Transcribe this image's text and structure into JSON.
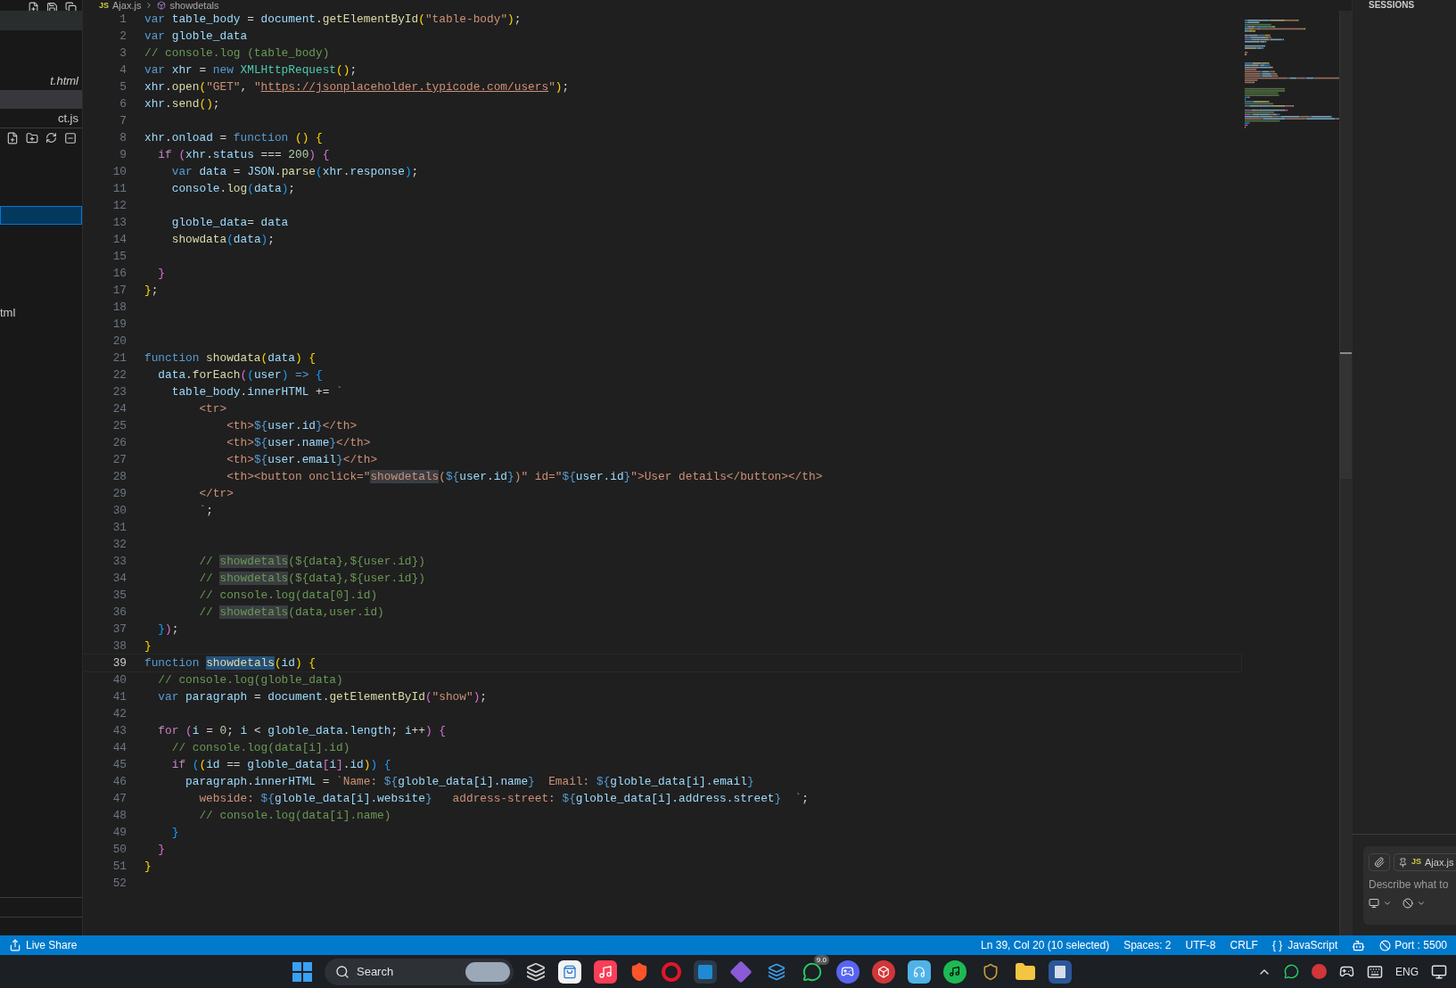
{
  "sidebar": {
    "files": [
      {
        "label": "t.html",
        "italic": true,
        "selected": false
      },
      {
        "selected": true
      },
      {
        "label": "ct.js",
        "italic": false,
        "selected": false
      }
    ],
    "tree": [
      {
        "focused": true
      },
      {
        "label": "tml",
        "focused": false
      }
    ]
  },
  "breadcrumb": {
    "file_badge": "JS",
    "file": "Ajax.js",
    "symbol": "showdetals"
  },
  "editor": {
    "lines": [
      {
        "number": "1",
        "current": false,
        "tokens": [
          {
            "text": "var",
            "kind": "kw"
          },
          {
            "text": " table_body",
            "kind": "v"
          },
          {
            "text": " = ",
            "kind": "p"
          },
          {
            "text": "document",
            "kind": "v"
          },
          {
            "text": ".",
            "kind": "p"
          },
          {
            "text": "getElementById",
            "kind": "fn"
          },
          {
            "text": "(",
            "kind": "b1"
          },
          {
            "text": "\"table-body\"",
            "kind": "str"
          },
          {
            "text": ")",
            "kind": "b1"
          },
          {
            "text": ";",
            "kind": "p"
          }
        ]
      },
      {
        "number": "2",
        "current": false,
        "tokens": [
          {
            "text": "var",
            "kind": "kw"
          },
          {
            "text": " globle_data",
            "kind": "v"
          }
        ]
      },
      {
        "number": "3",
        "current": false,
        "tokens": [
          {
            "text": "// console.log (table_body)",
            "kind": "cm"
          }
        ]
      },
      {
        "number": "4",
        "current": false,
        "tokens": [
          {
            "text": "var",
            "kind": "kw"
          },
          {
            "text": " xhr",
            "kind": "v"
          },
          {
            "text": " = ",
            "kind": "p"
          },
          {
            "text": "new",
            "kind": "kw"
          },
          {
            "text": " XMLHttpRequest",
            "kind": "cls"
          },
          {
            "text": "()",
            "kind": "b1"
          },
          {
            "text": ";",
            "kind": "p"
          }
        ]
      },
      {
        "number": "5",
        "current": false,
        "tokens": [
          {
            "text": "xhr",
            "kind": "v"
          },
          {
            "text": ".",
            "kind": "p"
          },
          {
            "text": "open",
            "kind": "fn"
          },
          {
            "text": "(",
            "kind": "b1"
          },
          {
            "text": "\"GET\"",
            "kind": "str"
          },
          {
            "text": ", ",
            "kind": "p"
          },
          {
            "text": "\"",
            "kind": "str"
          },
          {
            "text": "https://jsonplaceholder.typicode.com/users",
            "kind": "link"
          },
          {
            "text": "\"",
            "kind": "str"
          },
          {
            "text": ")",
            "kind": "b1"
          },
          {
            "text": ";",
            "kind": "p"
          }
        ]
      },
      {
        "number": "6",
        "current": false,
        "tokens": [
          {
            "text": "xhr",
            "kind": "v"
          },
          {
            "text": ".",
            "kind": "p"
          },
          {
            "text": "send",
            "kind": "fn"
          },
          {
            "text": "()",
            "kind": "b1"
          },
          {
            "text": ";",
            "kind": "p"
          }
        ]
      },
      {
        "number": "7",
        "current": false
      },
      {
        "number": "8",
        "current": false,
        "tokens": [
          {
            "text": "xhr",
            "kind": "v"
          },
          {
            "text": ".",
            "kind": "p"
          },
          {
            "text": "onload",
            "kind": "v"
          },
          {
            "text": " = ",
            "kind": "p"
          },
          {
            "text": "function",
            "kind": "kw"
          },
          {
            "text": " ()",
            "kind": "b1"
          },
          {
            "text": " {",
            "kind": "b1"
          }
        ]
      },
      {
        "number": "9",
        "current": false,
        "tokens": [
          {
            "text": "  if",
            "kind": "ctrl"
          },
          {
            "text": " (",
            "kind": "b2"
          },
          {
            "text": "xhr",
            "kind": "v"
          },
          {
            "text": ".",
            "kind": "p"
          },
          {
            "text": "status",
            "kind": "v"
          },
          {
            "text": " === ",
            "kind": "p"
          },
          {
            "text": "200",
            "kind": "num"
          },
          {
            "text": ")",
            "kind": "b2"
          },
          {
            "text": " {",
            "kind": "b2"
          }
        ]
      },
      {
        "number": "10",
        "current": false,
        "tokens": [
          {
            "text": "    var",
            "kind": "kw"
          },
          {
            "text": " data",
            "kind": "v"
          },
          {
            "text": " = ",
            "kind": "p"
          },
          {
            "text": "JSON",
            "kind": "v"
          },
          {
            "text": ".",
            "kind": "p"
          },
          {
            "text": "parse",
            "kind": "fn"
          },
          {
            "text": "(",
            "kind": "b3"
          },
          {
            "text": "xhr",
            "kind": "v"
          },
          {
            "text": ".",
            "kind": "p"
          },
          {
            "text": "response",
            "kind": "v"
          },
          {
            "text": ")",
            "kind": "b3"
          },
          {
            "text": ";",
            "kind": "p"
          }
        ]
      },
      {
        "number": "11",
        "current": false,
        "tokens": [
          {
            "text": "    console",
            "kind": "v"
          },
          {
            "text": ".",
            "kind": "p"
          },
          {
            "text": "log",
            "kind": "fn"
          },
          {
            "text": "(",
            "kind": "b3"
          },
          {
            "text": "data",
            "kind": "v"
          },
          {
            "text": ")",
            "kind": "b3"
          },
          {
            "text": ";",
            "kind": "p"
          }
        ]
      },
      {
        "number": "12",
        "current": false
      },
      {
        "number": "13",
        "current": false,
        "tokens": [
          {
            "text": "    globle_data",
            "kind": "v"
          },
          {
            "text": "= ",
            "kind": "p"
          },
          {
            "text": "data",
            "kind": "v"
          }
        ]
      },
      {
        "number": "14",
        "current": false,
        "tokens": [
          {
            "text": "    showdata",
            "kind": "fn"
          },
          {
            "text": "(",
            "kind": "b3"
          },
          {
            "text": "data",
            "kind": "v"
          },
          {
            "text": ")",
            "kind": "b3"
          },
          {
            "text": ";",
            "kind": "p"
          }
        ]
      },
      {
        "number": "15",
        "current": false
      },
      {
        "number": "16",
        "current": false,
        "tokens": [
          {
            "text": "  }",
            "kind": "b2"
          }
        ]
      },
      {
        "number": "17",
        "current": false,
        "tokens": [
          {
            "text": "}",
            "kind": "b1"
          },
          {
            "text": ";",
            "kind": "p"
          }
        ]
      },
      {
        "number": "18",
        "current": false
      },
      {
        "number": "19",
        "current": false
      },
      {
        "number": "20",
        "current": false
      },
      {
        "number": "21",
        "current": false,
        "tokens": [
          {
            "text": "function",
            "kind": "kw"
          },
          {
            "text": " showdata",
            "kind": "fn"
          },
          {
            "text": "(",
            "kind": "b1"
          },
          {
            "text": "data",
            "kind": "v"
          },
          {
            "text": ")",
            "kind": "b1"
          },
          {
            "text": " {",
            "kind": "b1"
          }
        ]
      },
      {
        "number": "22",
        "current": false,
        "tokens": [
          {
            "text": "  data",
            "kind": "v"
          },
          {
            "text": ".",
            "kind": "p"
          },
          {
            "text": "forEach",
            "kind": "fn"
          },
          {
            "text": "(",
            "kind": "b2"
          },
          {
            "text": "(",
            "kind": "b3"
          },
          {
            "text": "user",
            "kind": "v"
          },
          {
            "text": ")",
            "kind": "b3"
          },
          {
            "text": " =>",
            "kind": "kw"
          },
          {
            "text": " {",
            "kind": "b3"
          }
        ]
      },
      {
        "number": "23",
        "current": false,
        "tokens": [
          {
            "text": "    table_body",
            "kind": "v"
          },
          {
            "text": ".",
            "kind": "p"
          },
          {
            "text": "innerHTML",
            "kind": "v"
          },
          {
            "text": " += ",
            "kind": "p"
          },
          {
            "text": "`",
            "kind": "str"
          }
        ]
      },
      {
        "number": "24",
        "current": false,
        "tokens": [
          {
            "text": "        <tr>",
            "kind": "str"
          }
        ]
      },
      {
        "number": "25",
        "current": false,
        "tokens": [
          {
            "text": "            <th>",
            "kind": "str"
          },
          {
            "text": "${",
            "kind": "kw"
          },
          {
            "text": "user.id",
            "kind": "v"
          },
          {
            "text": "}",
            "kind": "kw"
          },
          {
            "text": "</th>",
            "kind": "str"
          }
        ]
      },
      {
        "number": "26",
        "current": false,
        "tokens": [
          {
            "text": "            <th>",
            "kind": "str"
          },
          {
            "text": "${",
            "kind": "kw"
          },
          {
            "text": "user.name",
            "kind": "v"
          },
          {
            "text": "}",
            "kind": "kw"
          },
          {
            "text": "</th>",
            "kind": "str"
          }
        ]
      },
      {
        "number": "27",
        "current": false,
        "tokens": [
          {
            "text": "            <th>",
            "kind": "str"
          },
          {
            "text": "${",
            "kind": "kw"
          },
          {
            "text": "user.email",
            "kind": "v"
          },
          {
            "text": "}",
            "kind": "kw"
          },
          {
            "text": "</th>",
            "kind": "str"
          }
        ]
      },
      {
        "number": "28",
        "current": false,
        "tokens": [
          {
            "text": "            <th><button onclick=\"",
            "kind": "str"
          },
          {
            "text": "showdetals",
            "kind": "str_occurrence"
          },
          {
            "text": "(",
            "kind": "str"
          },
          {
            "text": "${",
            "kind": "kw"
          },
          {
            "text": "user.id",
            "kind": "v"
          },
          {
            "text": "}",
            "kind": "kw"
          },
          {
            "text": ")\" id=\"",
            "kind": "str"
          },
          {
            "text": "${",
            "kind": "kw"
          },
          {
            "text": "user.id",
            "kind": "v"
          },
          {
            "text": "}",
            "kind": "kw"
          },
          {
            "text": "\">User details</button></th>",
            "kind": "str"
          }
        ]
      },
      {
        "number": "29",
        "current": false,
        "tokens": [
          {
            "text": "        </tr>",
            "kind": "str"
          }
        ]
      },
      {
        "number": "30",
        "current": false,
        "tokens": [
          {
            "text": "        `",
            "kind": "str"
          },
          {
            "text": ";",
            "kind": "p"
          }
        ]
      },
      {
        "number": "31",
        "current": false
      },
      {
        "number": "32",
        "current": false
      },
      {
        "number": "33",
        "current": false,
        "tokens": [
          {
            "text": "        // ",
            "kind": "cm"
          },
          {
            "text": "showdetals",
            "kind": "cm_occurrence"
          },
          {
            "text": "(${data},${user.id})",
            "kind": "cm"
          }
        ]
      },
      {
        "number": "34",
        "current": false,
        "tokens": [
          {
            "text": "        // ",
            "kind": "cm"
          },
          {
            "text": "showdetals",
            "kind": "cm_occurrence"
          },
          {
            "text": "(${data},${user.id})",
            "kind": "cm"
          }
        ]
      },
      {
        "number": "35",
        "current": false,
        "tokens": [
          {
            "text": "        // console.log(data[0].id)",
            "kind": "cm"
          }
        ]
      },
      {
        "number": "36",
        "current": false,
        "tokens": [
          {
            "text": "        // ",
            "kind": "cm"
          },
          {
            "text": "showdetals",
            "kind": "cm_occurrence"
          },
          {
            "text": "(data,user.id)",
            "kind": "cm"
          }
        ]
      },
      {
        "number": "37",
        "current": false,
        "tokens": [
          {
            "text": "  }",
            "kind": "b3"
          },
          {
            "text": ")",
            "kind": "b2"
          },
          {
            "text": ";",
            "kind": "p"
          }
        ]
      },
      {
        "number": "38",
        "current": false,
        "tokens": [
          {
            "text": "}",
            "kind": "b1"
          }
        ]
      },
      {
        "number": "39",
        "current": true,
        "tokens": [
          {
            "text": "function ",
            "kind": "kw"
          },
          {
            "text": "showdetals",
            "kind": "fn_selection"
          },
          {
            "text": "(",
            "kind": "b1"
          },
          {
            "text": "id",
            "kind": "v"
          },
          {
            "text": ")",
            "kind": "b1"
          },
          {
            "text": " {",
            "kind": "b1"
          }
        ]
      },
      {
        "number": "40",
        "current": false,
        "tokens": [
          {
            "text": "  // console.log(globle_data)",
            "kind": "cm"
          }
        ]
      },
      {
        "number": "41",
        "current": false,
        "tokens": [
          {
            "text": "  var",
            "kind": "kw"
          },
          {
            "text": " paragraph",
            "kind": "v"
          },
          {
            "text": " = ",
            "kind": "p"
          },
          {
            "text": "document",
            "kind": "v"
          },
          {
            "text": ".",
            "kind": "p"
          },
          {
            "text": "getElementById",
            "kind": "fn"
          },
          {
            "text": "(",
            "kind": "b2"
          },
          {
            "text": "\"show\"",
            "kind": "str"
          },
          {
            "text": ")",
            "kind": "b2"
          },
          {
            "text": ";",
            "kind": "p"
          }
        ]
      },
      {
        "number": "42",
        "current": false
      },
      {
        "number": "43",
        "current": false,
        "tokens": [
          {
            "text": "  for",
            "kind": "ctrl"
          },
          {
            "text": " (",
            "kind": "b2"
          },
          {
            "text": "i",
            "kind": "v"
          },
          {
            "text": " = ",
            "kind": "p"
          },
          {
            "text": "0",
            "kind": "num"
          },
          {
            "text": "; ",
            "kind": "p"
          },
          {
            "text": "i",
            "kind": "v"
          },
          {
            "text": " < ",
            "kind": "p"
          },
          {
            "text": "globle_data",
            "kind": "v"
          },
          {
            "text": ".",
            "kind": "p"
          },
          {
            "text": "length",
            "kind": "v"
          },
          {
            "text": "; ",
            "kind": "p"
          },
          {
            "text": "i",
            "kind": "v"
          },
          {
            "text": "++",
            "kind": "p"
          },
          {
            "text": ")",
            "kind": "b2"
          },
          {
            "text": " {",
            "kind": "b2"
          }
        ]
      },
      {
        "number": "44",
        "current": false,
        "tokens": [
          {
            "text": "    // console.log(data[i].id)",
            "kind": "cm"
          }
        ]
      },
      {
        "number": "45",
        "current": false,
        "tokens": [
          {
            "text": "    if",
            "kind": "ctrl"
          },
          {
            "text": " (",
            "kind": "b3"
          },
          {
            "text": "(",
            "kind": "b1"
          },
          {
            "text": "id",
            "kind": "v"
          },
          {
            "text": " == ",
            "kind": "p"
          },
          {
            "text": "globle_data",
            "kind": "v"
          },
          {
            "text": "[",
            "kind": "b2"
          },
          {
            "text": "i",
            "kind": "v"
          },
          {
            "text": "]",
            "kind": "b2"
          },
          {
            "text": ".",
            "kind": "p"
          },
          {
            "text": "id",
            "kind": "v"
          },
          {
            "text": ")",
            "kind": "b1"
          },
          {
            "text": ")",
            "kind": "b3"
          },
          {
            "text": " {",
            "kind": "b3"
          }
        ]
      },
      {
        "number": "46",
        "current": false,
        "tokens": [
          {
            "text": "      paragraph",
            "kind": "v"
          },
          {
            "text": ".",
            "kind": "p"
          },
          {
            "text": "innerHTML",
            "kind": "v"
          },
          {
            "text": " = ",
            "kind": "p"
          },
          {
            "text": "`Name: ",
            "kind": "str"
          },
          {
            "text": "${",
            "kind": "kw"
          },
          {
            "text": "globle_data[i].name",
            "kind": "v"
          },
          {
            "text": "}",
            "kind": "kw"
          },
          {
            "text": "  Email: ",
            "kind": "str"
          },
          {
            "text": "${",
            "kind": "kw"
          },
          {
            "text": "globle_data[i].email",
            "kind": "v"
          },
          {
            "text": "}",
            "kind": "kw"
          }
        ]
      },
      {
        "number": "47",
        "current": false,
        "tokens": [
          {
            "text": "        webside: ",
            "kind": "str"
          },
          {
            "text": "${",
            "kind": "kw"
          },
          {
            "text": "globle_data[i].website",
            "kind": "v"
          },
          {
            "text": "}",
            "kind": "kw"
          },
          {
            "text": "   address-street: ",
            "kind": "str"
          },
          {
            "text": "${",
            "kind": "kw"
          },
          {
            "text": "globle_data[i].address.street",
            "kind": "v"
          },
          {
            "text": "}",
            "kind": "kw"
          },
          {
            "text": "  `",
            "kind": "str"
          },
          {
            "text": ";",
            "kind": "p"
          }
        ]
      },
      {
        "number": "48",
        "current": false,
        "tokens": [
          {
            "text": "        // console.log(data[i].name)",
            "kind": "cm"
          }
        ]
      },
      {
        "number": "49",
        "current": false,
        "tokens": [
          {
            "text": "    }",
            "kind": "b3"
          }
        ]
      },
      {
        "number": "50",
        "current": false,
        "tokens": [
          {
            "text": "  }",
            "kind": "b2"
          }
        ]
      },
      {
        "number": "51",
        "current": false,
        "tokens": [
          {
            "text": "}",
            "kind": "b1"
          }
        ]
      },
      {
        "number": "52",
        "current": false
      }
    ]
  },
  "right_panel": {
    "title": "SESSIONS",
    "chat": {
      "context_badge": "JS",
      "context_file": "Ajax.js",
      "placeholder": "Describe what to"
    }
  },
  "status_bar": {
    "left": "Live Share",
    "right": [
      {
        "kind": "text",
        "text": "Ln 39, Col 20 (10 selected)"
      },
      {
        "kind": "text",
        "text": "Spaces: 2"
      },
      {
        "kind": "text",
        "text": "UTF-8"
      },
      {
        "kind": "text",
        "text": "CRLF"
      },
      {
        "kind": "language",
        "braces": "{ }",
        "text": "JavaScript"
      },
      {
        "kind": "copilot"
      },
      {
        "kind": "port",
        "text": "Port : 5500"
      }
    ]
  },
  "taskbar": {
    "search": "Search",
    "chat_badge": "9.0",
    "language": "ENG"
  }
}
